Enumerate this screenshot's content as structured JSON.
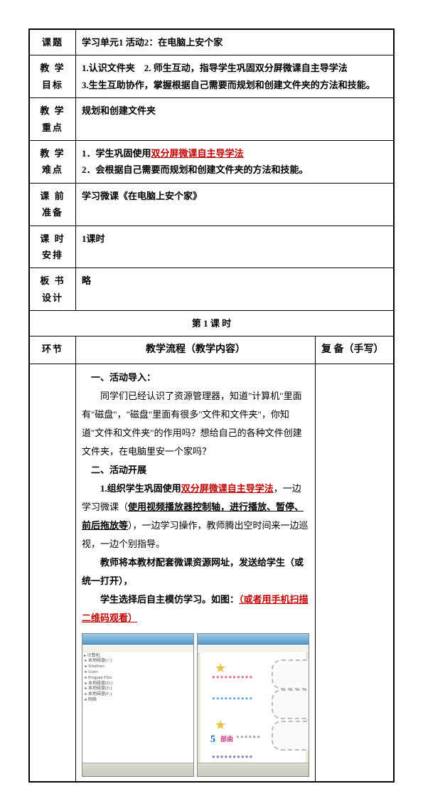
{
  "rows": {
    "topic_label": "课题",
    "topic_value": "学习单元1 活动2：在电脑上安个家",
    "goal_label": "教 学目标",
    "goal_line1a": "1.认识文件夹",
    "goal_line1b": "2. 师生互动，指导学生巩固双分屏微课自主导学法",
    "goal_line2": "3.生生互助协作，掌握根据自己需要而规划和创建文件夹的方法和技能。",
    "key_label": "教 学重点",
    "key_value": "规划和创建文件夹",
    "diff_label": "教 学难点",
    "diff_line1a": "1．学生巩固使用",
    "diff_line1b": "双分屏微课自主导学法",
    "diff_line2": "2．会根据自己需要而规划和创建文件夹的方法和技能。",
    "prep_label": "课 前准备",
    "prep_value": "学习微课《在电脑上安个家》",
    "time_label": "课 时安排",
    "time_value": "1课时",
    "board_label": "板 书设计",
    "board_value": "略"
  },
  "section_header": "第  1  课 时",
  "flow": {
    "col1_label": "环节",
    "col2_label": "教学流程（教学内容）",
    "col3_label": "复    备（手写）"
  },
  "content": {
    "h1": "一、活动导入：",
    "p1": "同学们已经认识了资源管理器，知道\"计算机\"里面有\"磁盘\"，\"磁盘\"里面有很多\"文件和文件夹\"，你知道\"文件和文件夹\"的作用吗？想给自己的各种文件创建文件夹，在电脑里安一个家吗？",
    "h2": "二、活动开展",
    "p2a": "1.组织学生巩固使用",
    "p2b": "双分屏微课自主导学法",
    "p2c": "，一边学习微课（",
    "p2d": "使用视频播放器控制轴，进行播放、暂停、前后拖放等",
    "p2e": "），一边学习操作，教师腾出空时间来一边巡视，一边个别指导。",
    "p3": "教师将本教材配套微课资源网址，发送给学生（或统一打开），",
    "p4a": "学生选择后自主模仿学习。如图：",
    "p4b": "（或者用手机扫描二维码观看）"
  },
  "screenshot": {
    "tree_lines": "▸ 计算机\n ▸ 本地磁盘(C:)\n ▸ Windows\n ▸ Users\n ▸ Program Files\n ▸ 本地磁盘(D:)\n ▸ 本地磁盘(E:)\n ▸ 本地磁盘(F:)\n ▸ 网络",
    "num5": "5",
    "num_suffix": "部曲"
  }
}
